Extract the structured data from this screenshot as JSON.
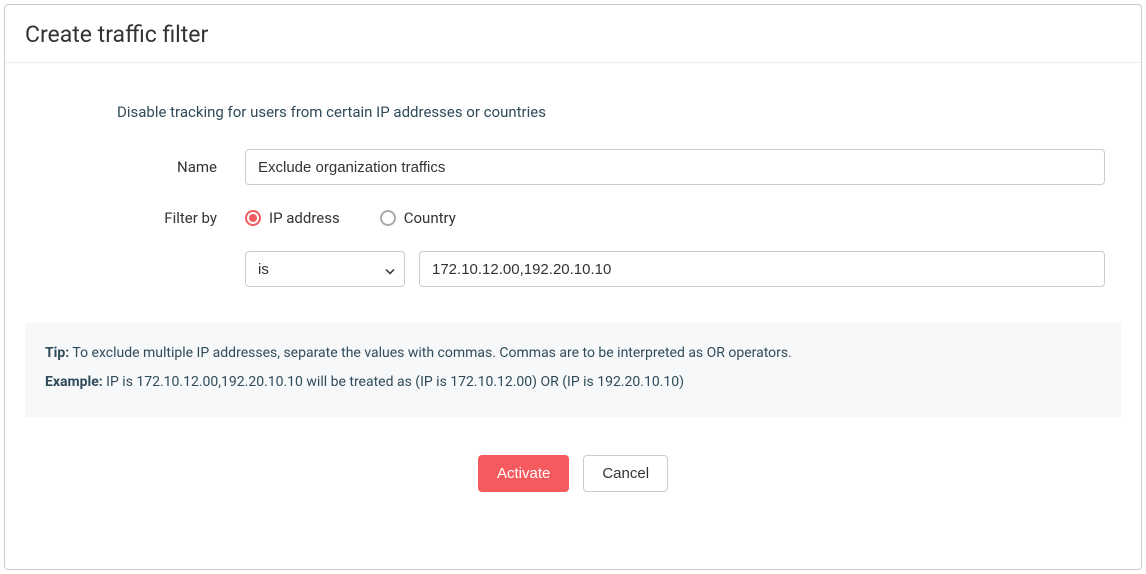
{
  "modal": {
    "title": "Create traffic filter",
    "description": "Disable tracking for users from certain IP addresses or countries"
  },
  "form": {
    "name_label": "Name",
    "name_value": "Exclude organization traffics",
    "filter_by_label": "Filter by",
    "radio_options": {
      "ip": "IP address",
      "country": "Country"
    },
    "condition_operator": "is",
    "condition_value": "172.10.12.00,192.20.10.10"
  },
  "tip": {
    "tip_label": "Tip:",
    "tip_text": " To exclude multiple IP addresses, separate the values with commas. Commas are to be interpreted as OR operators.",
    "example_label": "Example:",
    "example_text": " IP is 172.10.12.00,192.20.10.10 will be treated as (IP is 172.10.12.00) OR (IP is 192.20.10.10)"
  },
  "buttons": {
    "activate": "Activate",
    "cancel": "Cancel"
  }
}
